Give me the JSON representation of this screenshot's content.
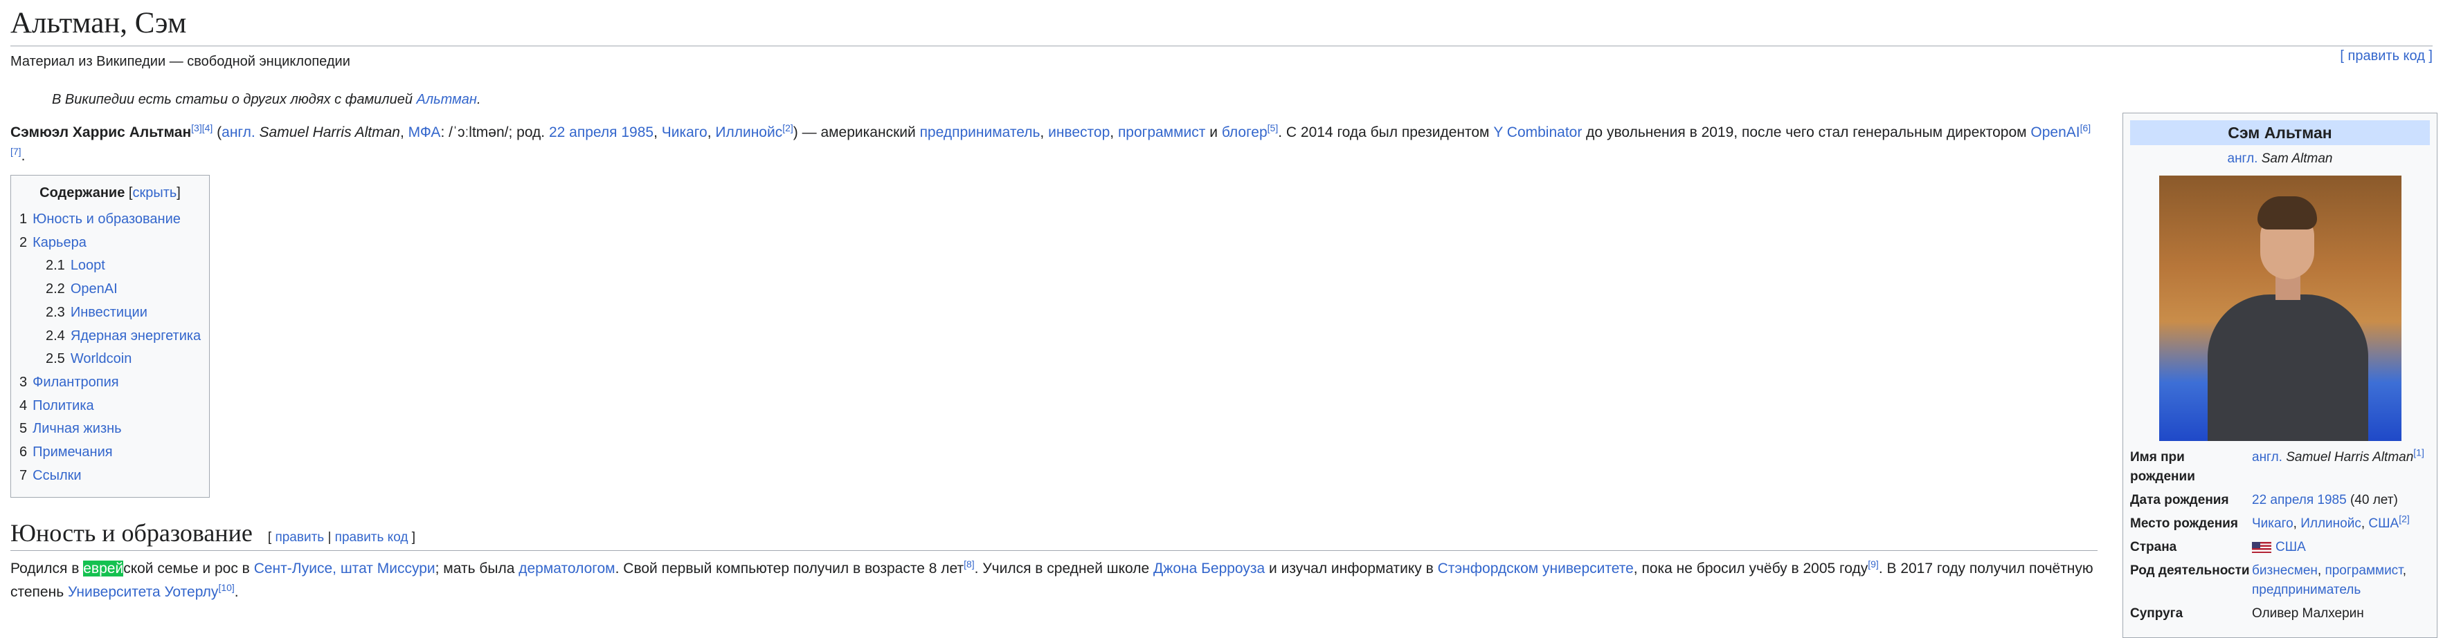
{
  "title": "Альтман, Сэм",
  "tagline": "Материал из Википедии — свободной энциклопедии",
  "edit_code_top": "[ править код ]",
  "hatnote": {
    "text": "В Википедии есть статьи о других людях с фамилией ",
    "link": "Альтман",
    "end": "."
  },
  "lead": {
    "name": "Сэмюэл Харрис Альтман",
    "ref1": "[3][4]",
    "p1": " (",
    "lang_link": "англ.",
    "name_en": " Samuel Harris Altman",
    "p2": ", ",
    "ipa_link": "МФА",
    "ipa": ": /ˈɔːltmən/",
    "p3": "; род. ",
    "date_link": "22 апреля 1985",
    "p4": ", ",
    "city_link": "Чикаго",
    "p5": ", ",
    "state_link": "Иллинойс",
    "ref2": "[2]",
    "p6": ") — американский ",
    "occ1": "предприниматель",
    "p7": ", ",
    "occ2": "инвестор",
    "p8": ", ",
    "occ3": "программист",
    "p9": " и ",
    "occ4": "блогер",
    "ref3": "[5]",
    "p10": ". С 2014 года был президентом ",
    "yc_link": "Y Combinator",
    "p11": " до увольнения в 2019, после чего стал генеральным директором ",
    "openai_link": "OpenAI",
    "ref4": "[6][7]",
    "p12": "."
  },
  "toc": {
    "heading": "Содержание",
    "hide_open": " [",
    "hide_link": "скрыть",
    "hide_close": "]",
    "items": [
      {
        "num": "1",
        "label": "Юность и образование"
      },
      {
        "num": "2",
        "label": "Карьера"
      },
      {
        "num": "2.1",
        "label": "Loopt"
      },
      {
        "num": "2.2",
        "label": "OpenAI"
      },
      {
        "num": "2.3",
        "label": "Инвестиции"
      },
      {
        "num": "2.4",
        "label": "Ядерная энергетика"
      },
      {
        "num": "2.5",
        "label": "Worldcoin"
      },
      {
        "num": "3",
        "label": "Филантропия"
      },
      {
        "num": "4",
        "label": "Политика"
      },
      {
        "num": "5",
        "label": "Личная жизнь"
      },
      {
        "num": "6",
        "label": "Примечания"
      },
      {
        "num": "7",
        "label": "Ссылки"
      }
    ]
  },
  "section_youth": {
    "heading": "Юность и образование",
    "edit_open": "[ ",
    "edit_link": "править",
    "edit_sep": " | ",
    "edit_code_link": "править код",
    "edit_close": " ]",
    "s1": "Родился в ",
    "hl": "еврей",
    "s2": "ской семье и рос в ",
    "city_link": "Сент-Луисе, штат Миссури",
    "s3": "; мать была ",
    "derm_link": "дерматологом",
    "s4": ". Свой первый компьютер получил в возрасте 8 лет",
    "ref8": "[8]",
    "s5": ". Учился в средней школе ",
    "school_link": "Джона Берроуза",
    "s6": " и изучал информатику в ",
    "stanford_link": "Стэнфордском университете",
    "s7": ", пока не бросил учёбу в 2005 году",
    "ref9": "[9]",
    "s8": ". В 2017 году получил почётную степень ",
    "waterloo_link": "Университета Уотерлу",
    "ref10": "[10]",
    "s9": "."
  },
  "infobox": {
    "title": "Сэм Альтман",
    "sub_lang": "англ.",
    "sub_name": " Sam Altman",
    "rows": {
      "birth_name_label": "Имя при рождении",
      "birth_name_lang": "англ.",
      "birth_name_value": " Samuel Harris Altman",
      "birth_name_ref": "[1]",
      "dob_label": "Дата рождения",
      "dob_link": "22 апреля 1985",
      "dob_age": " (40 лет)",
      "pob_label": "Место рождения",
      "pob_city": "Чикаго",
      "pob_state": "Иллинойс",
      "pob_country": "США",
      "pob_ref": "[2]",
      "country_label": "Страна",
      "country_value": "США",
      "occupation_label": "Род деятельности",
      "occ1": "бизнесмен",
      "occ2": "программист",
      "occ3": "предприниматель",
      "spouse_label": "Супруга",
      "spouse_value": "Оливер Малхерин"
    }
  }
}
